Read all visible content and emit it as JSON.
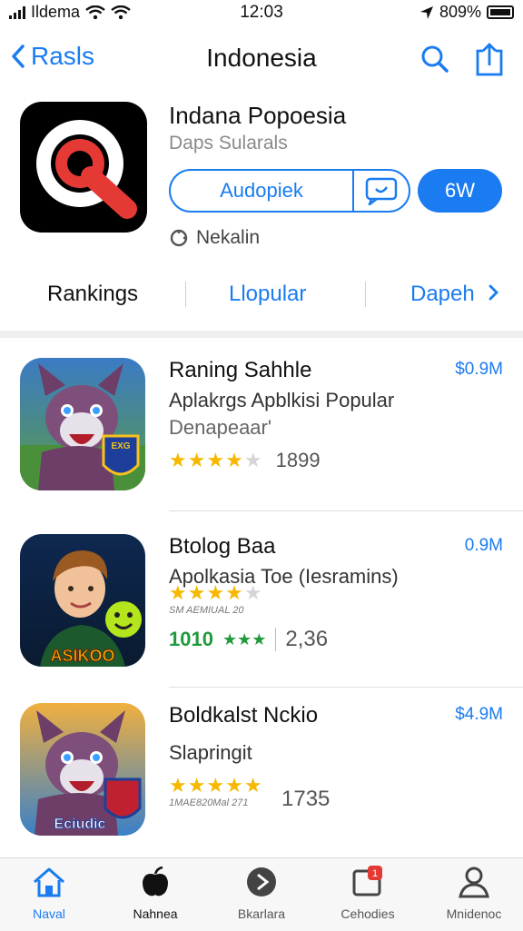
{
  "status_bar": {
    "carrier": "Ildema",
    "time": "12:03",
    "battery": "809%"
  },
  "nav": {
    "back_label": "Rasls",
    "title": "Indonesia"
  },
  "hero": {
    "title": "Indana Popoesia",
    "subtitle": "Daps Sularals",
    "action_label": "Audopiek",
    "get_label": "6W",
    "note": "Nekalin"
  },
  "tabs": [
    {
      "label": "Rankings"
    },
    {
      "label": "Llopular"
    },
    {
      "label": "Dapeh"
    }
  ],
  "apps": [
    {
      "name": "Raning Sahhle",
      "desc1": "Aplakrgs Apblkisi Popular",
      "desc2": "Denapeaar'",
      "rating_count": "1899",
      "price": "$0.9M",
      "stars": 4,
      "badge": "EXG"
    },
    {
      "name": "Btolog Baa",
      "desc1": "Apolkasia Toe (Iesramins)",
      "subdetail": "SM AEMIUAL 20",
      "rank": "1010",
      "stats": "2,36",
      "price": "0.9M",
      "stars": 4,
      "badge": "ASIKOO"
    },
    {
      "name": "Boldkalst Nckio",
      "desc1": "Slapringit",
      "subdetail": "1MAE820Mal 271",
      "rating_count": "1735",
      "price": "$4.9M",
      "stars": 5,
      "badge": "Eciudic"
    }
  ],
  "tab_bar": [
    {
      "label": "Naval",
      "icon": "home-icon"
    },
    {
      "label": "Nahnea",
      "icon": "apple-icon"
    },
    {
      "label": "Bkarlara",
      "icon": "play-icon"
    },
    {
      "label": "Cehodies",
      "icon": "notification-icon",
      "badge": "1"
    },
    {
      "label": "Mnidenoc",
      "icon": "profile-icon"
    }
  ],
  "colors": {
    "accent": "#1a7cf0",
    "star": "#f6b800",
    "green": "#1f9a3c"
  }
}
